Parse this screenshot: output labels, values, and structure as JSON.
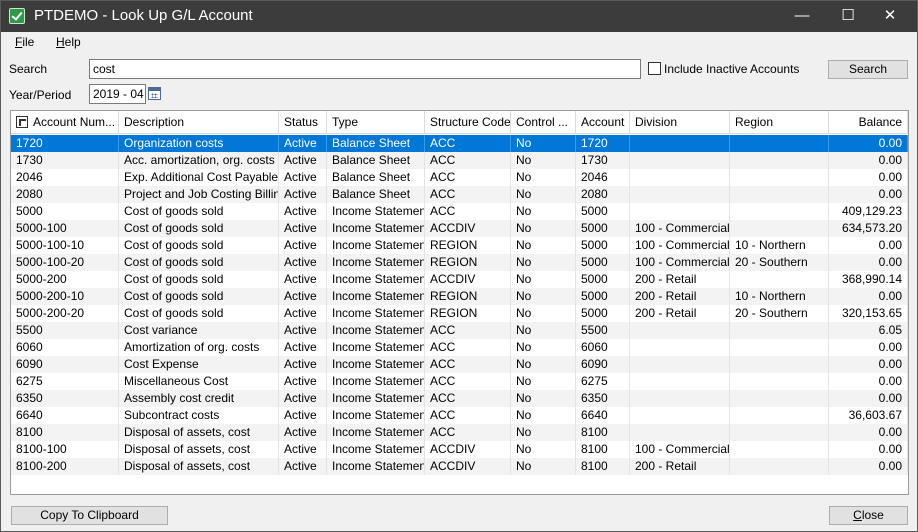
{
  "window": {
    "title": "PTDEMO - Look Up G/L Account",
    "minimize_glyph": "—",
    "maximize_glyph": "☐",
    "close_glyph": "✕"
  },
  "menu": {
    "file_accel": "F",
    "file_rest": "ile",
    "help_accel": "H",
    "help_rest": "elp"
  },
  "search": {
    "label": "Search",
    "value": "cost",
    "include_inactive_label": "Include Inactive Accounts",
    "include_inactive_checked": false,
    "button_label": "Search"
  },
  "period": {
    "label": "Year/Period",
    "value": "2019 - 04"
  },
  "table": {
    "columns": [
      "Account Num...",
      "Description",
      "Status",
      "Type",
      "Structure Code",
      "Control ...",
      "Account",
      "Division",
      "Region",
      "Balance"
    ],
    "rows": [
      [
        "1720",
        "Organization costs",
        "Active",
        "Balance Sheet",
        "ACC",
        "No",
        "1720",
        "",
        "",
        "0.00"
      ],
      [
        "1730",
        "Acc. amortization, org. costs",
        "Active",
        "Balance Sheet",
        "ACC",
        "No",
        "1730",
        "",
        "",
        "0.00"
      ],
      [
        "2046",
        "Exp. Additional Cost Payables...",
        "Active",
        "Balance Sheet",
        "ACC",
        "No",
        "2046",
        "",
        "",
        "0.00"
      ],
      [
        "2080",
        "Project and Job Costing Billings",
        "Active",
        "Balance Sheet",
        "ACC",
        "No",
        "2080",
        "",
        "",
        "0.00"
      ],
      [
        "5000",
        "Cost of goods sold",
        "Active",
        "Income Statement",
        "ACC",
        "No",
        "5000",
        "",
        "",
        "409,129.23"
      ],
      [
        "5000-100",
        "Cost of goods sold",
        "Active",
        "Income Statement",
        "ACCDIV",
        "No",
        "5000",
        "100 - Commercial",
        "",
        "634,573.20"
      ],
      [
        "5000-100-10",
        "Cost of goods sold",
        "Active",
        "Income Statement",
        "REGION",
        "No",
        "5000",
        "100 - Commercial",
        "10 - Northern",
        "0.00"
      ],
      [
        "5000-100-20",
        "Cost of goods sold",
        "Active",
        "Income Statement",
        "REGION",
        "No",
        "5000",
        "100 - Commercial",
        "20 - Southern",
        "0.00"
      ],
      [
        "5000-200",
        "Cost of goods sold",
        "Active",
        "Income Statement",
        "ACCDIV",
        "No",
        "5000",
        "200 - Retail",
        "",
        "368,990.14"
      ],
      [
        "5000-200-10",
        "Cost of goods sold",
        "Active",
        "Income Statement",
        "REGION",
        "No",
        "5000",
        "200 - Retail",
        "10 - Northern",
        "0.00"
      ],
      [
        "5000-200-20",
        "Cost of goods sold",
        "Active",
        "Income Statement",
        "REGION",
        "No",
        "5000",
        "200 - Retail",
        "20 - Southern",
        "320,153.65"
      ],
      [
        "5500",
        "Cost variance",
        "Active",
        "Income Statement",
        "ACC",
        "No",
        "5500",
        "",
        "",
        "6.05"
      ],
      [
        "6060",
        "Amortization of org. costs",
        "Active",
        "Income Statement",
        "ACC",
        "No",
        "6060",
        "",
        "",
        "0.00"
      ],
      [
        "6090",
        "Cost Expense",
        "Active",
        "Income Statement",
        "ACC",
        "No",
        "6090",
        "",
        "",
        "0.00"
      ],
      [
        "6275",
        "Miscellaneous Cost",
        "Active",
        "Income Statement",
        "ACC",
        "No",
        "6275",
        "",
        "",
        "0.00"
      ],
      [
        "6350",
        "Assembly cost credit",
        "Active",
        "Income Statement",
        "ACC",
        "No",
        "6350",
        "",
        "",
        "0.00"
      ],
      [
        "6640",
        "Subcontract costs",
        "Active",
        "Income Statement",
        "ACC",
        "No",
        "6640",
        "",
        "",
        "36,603.67"
      ],
      [
        "8100",
        "Disposal of assets, cost",
        "Active",
        "Income Statement",
        "ACC",
        "No",
        "8100",
        "",
        "",
        "0.00"
      ],
      [
        "8100-100",
        "Disposal of assets, cost",
        "Active",
        "Income Statement",
        "ACCDIV",
        "No",
        "8100",
        "100 - Commercial",
        "",
        "0.00"
      ],
      [
        "8100-200",
        "Disposal of assets, cost",
        "Active",
        "Income Statement",
        "ACCDIV",
        "No",
        "8100",
        "200 - Retail",
        "",
        "0.00"
      ]
    ],
    "selected_row": 0
  },
  "footer": {
    "copy_label": "Copy To Clipboard",
    "close_accel": "C",
    "close_rest": "lose"
  },
  "colors": {
    "titlebar": "#3c3c3c",
    "selection": "#0078d7"
  },
  "icons": [
    "app-icon",
    "minimize-icon",
    "maximize-icon",
    "close-icon",
    "calendar-icon",
    "sort-icon"
  ]
}
